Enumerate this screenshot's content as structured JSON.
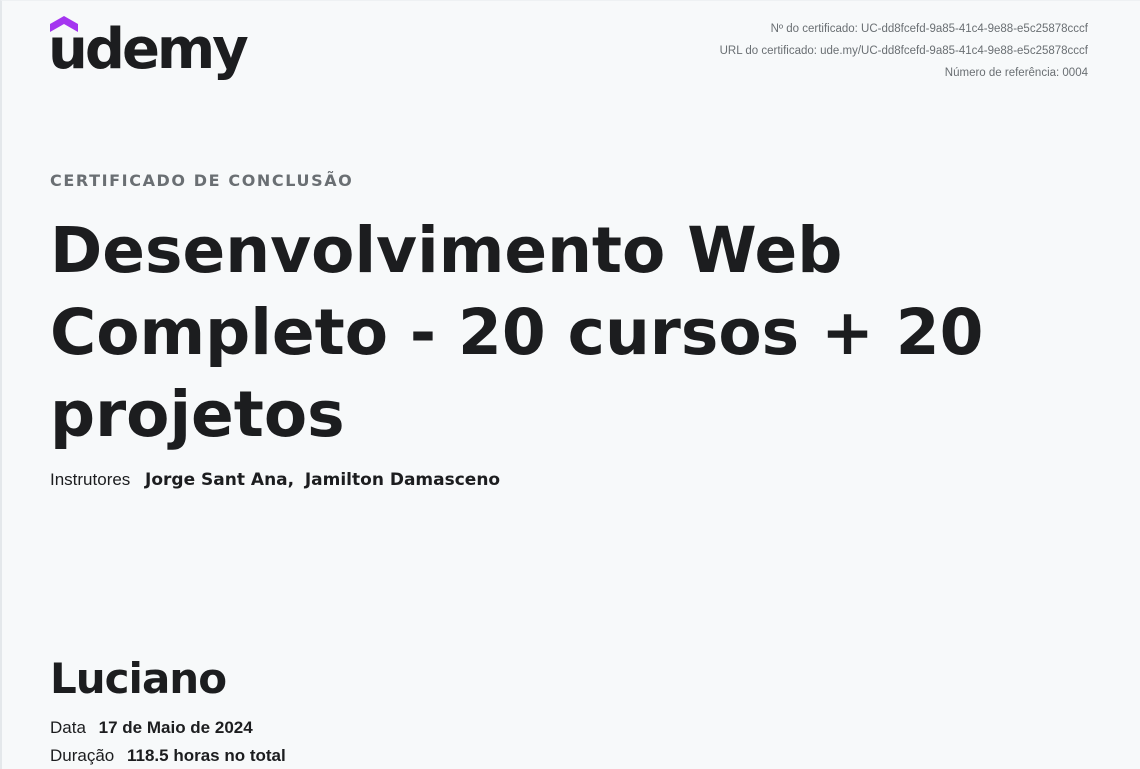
{
  "brand": {
    "name": "udemy",
    "accent": "#a435f0"
  },
  "certificate_meta": {
    "certificate_number": "Nº do certificado: UC-dd8fcefd-9a85-41c4-9e88-e5c25878cccf",
    "certificate_url": "URL do certificado: ude.my/UC-dd8fcefd-9a85-41c4-9e88-e5c25878cccf",
    "reference_number": "Número de referência: 0004"
  },
  "heading": {
    "eyebrow": "CERTIFICADO DE CONCLUSÃO",
    "course_title": "Desenvolvimento Web Completo - 20 cursos + 20 projetos"
  },
  "instructors": {
    "label": "Instrutores",
    "names": [
      "Jorge Sant Ana,",
      "Jamilton Damasceno"
    ]
  },
  "recipient": {
    "name": "Luciano"
  },
  "details": {
    "date_label": "Data",
    "date_value": "17 de Maio de 2024",
    "duration_label": "Duração",
    "duration_value": "118.5 horas no total"
  }
}
